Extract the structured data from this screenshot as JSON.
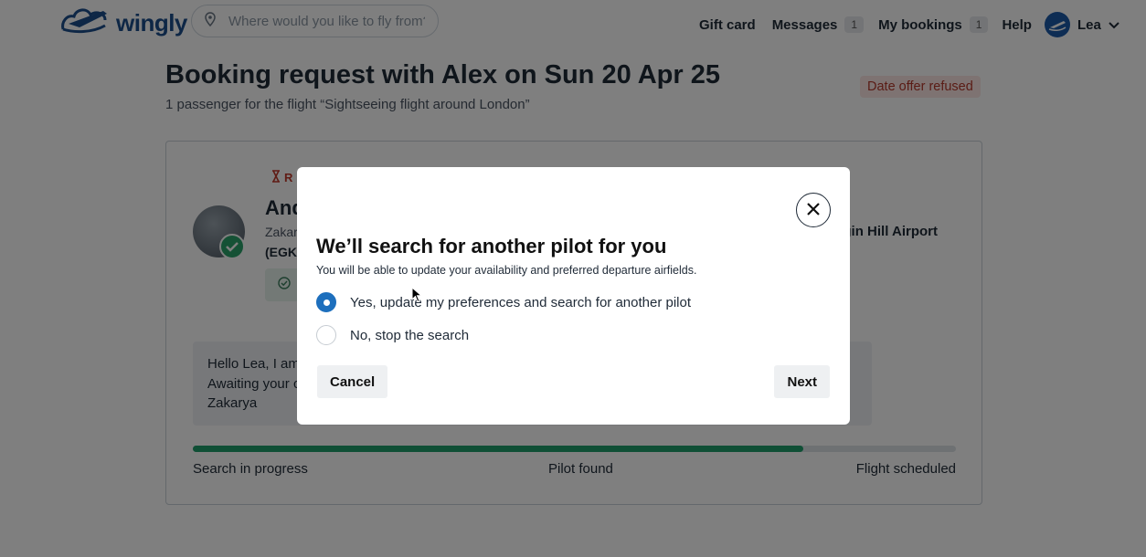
{
  "header": {
    "brand": "wingly",
    "search_placeholder": "Where would you like to fly from?",
    "nav": {
      "gift_card": "Gift card",
      "messages": "Messages",
      "messages_count": "1",
      "my_bookings": "My bookings",
      "bookings_count": "1",
      "help": "Help",
      "user_name": "Lea"
    }
  },
  "booking": {
    "title": "Booking request with Alex on Sun 20 Apr 25",
    "subtitle": "1 passenger for the flight “Sightseeing flight around London”",
    "status": "Date offer refused",
    "request_tag": "R",
    "pilot_name": "And",
    "pilot_base": "Zakar",
    "pilot_code": "(EGK",
    "airport": "gin Hill Airport",
    "message_lines": [
      "Hello Lea, I am a",
      "Awaiting your co",
      "Zakarya"
    ],
    "progress_fraction": 0.8,
    "progress_steps": [
      "Search in progress",
      "Pilot found",
      "Flight scheduled"
    ]
  },
  "modal": {
    "title": "We’ll search for another pilot for you",
    "description": "You will be able to update your availability and preferred departure airfields.",
    "options": [
      {
        "label": "Yes, update my preferences and search for another pilot",
        "selected": true
      },
      {
        "label": "No, stop the search",
        "selected": false
      }
    ],
    "cancel_label": "Cancel",
    "next_label": "Next"
  },
  "colors": {
    "brand": "#1d4f8c",
    "radio_selected": "#1d6fbd",
    "progress": "#1f9e6b",
    "status_text": "#b4382b"
  },
  "icons": [
    "wingly-logo-icon",
    "location-pin-icon",
    "chevron-down-icon",
    "hourglass-icon",
    "verified-check-icon",
    "circle-check-icon",
    "close-icon",
    "mouse-cursor-icon"
  ]
}
